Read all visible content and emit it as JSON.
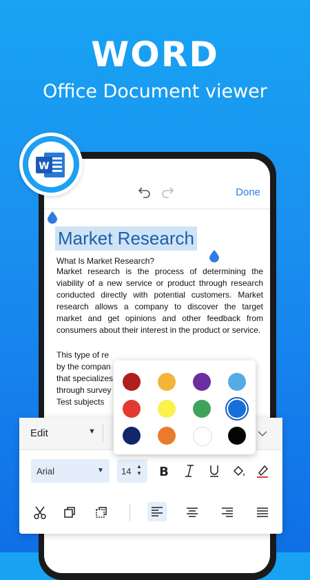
{
  "promo": {
    "headline": "WORD",
    "subline": "Office Document viewer"
  },
  "app": {
    "done_label": "Done"
  },
  "document": {
    "title": "Market Research",
    "question": "What Is Market Research?",
    "paragraph1": "Market research is the process of determining the viability of a new service or product through research conducted directly with potential customers. Market research allows a company to discover the target market and get opinions and other feedback from consumers about their interest in the product or service.",
    "paragraph2_lines": [
      "This type of re",
      "by the compan",
      "that specializes",
      "through survey",
      "Test subjects"
    ]
  },
  "toolbar": {
    "mode_label": "Edit",
    "font_name": "Arial",
    "font_size": "14"
  },
  "color_palette": {
    "selected": "#1570d9",
    "colors": [
      "#b01e1e",
      "#f2b53a",
      "#6a2fa0",
      "#55abe6",
      "#e23a2f",
      "#fbf24a",
      "#3fa35a",
      "#1570d9",
      "#10286b",
      "#e97b2c",
      "#ffffff",
      "#050505"
    ]
  }
}
